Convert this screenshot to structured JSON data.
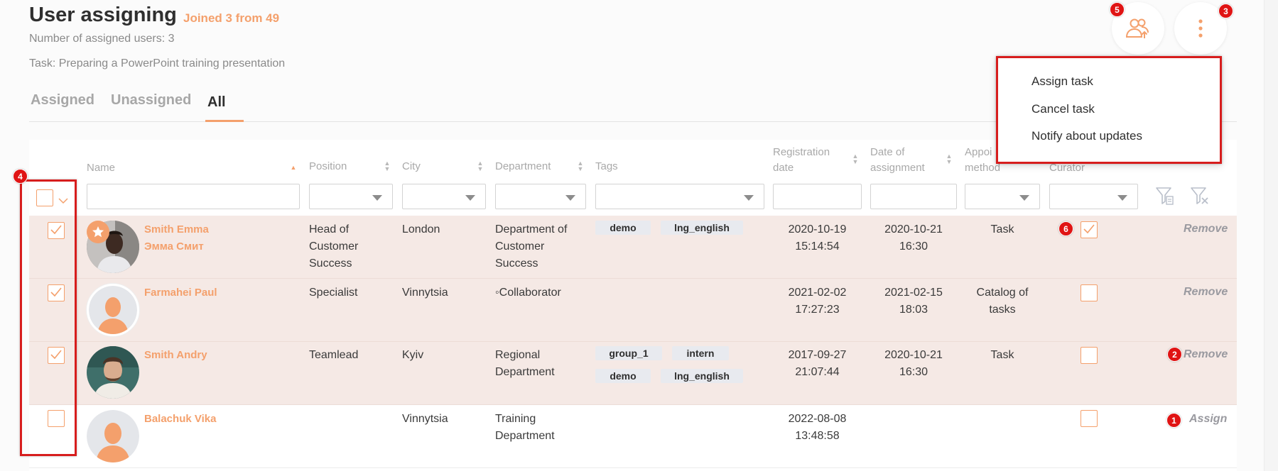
{
  "header": {
    "title": "User assigning",
    "joined": "Joined 3 from 49",
    "assigned_count": "Number of assigned users: 3",
    "task": "Task: Preparing a PowerPoint training presentation"
  },
  "tabs": [
    {
      "label": "Assigned"
    },
    {
      "label": "Unassigned"
    },
    {
      "label": "All"
    }
  ],
  "columns": {
    "name": "Name",
    "position": "Position",
    "city": "City",
    "department": "Department",
    "tags": "Tags",
    "registration_line1": "Registration",
    "registration_line2": "date",
    "assignment_line1": "Date of",
    "assignment_line2": "assignment",
    "appoint_line1": "Appoi",
    "appoint_line2": "method",
    "curator": "Curator"
  },
  "menu": {
    "items": [
      "Assign task",
      "Cancel task",
      "Notify about updates"
    ]
  },
  "badges": {
    "b1": "1",
    "b2": "2",
    "b3": "3",
    "b4": "4",
    "b5": "5",
    "b6": "6"
  },
  "rows": [
    {
      "name_line1": "Smith Emma",
      "name_line2": "Эмма Смит",
      "position": [
        "Head of",
        "Customer",
        "Success"
      ],
      "city": "London",
      "department": [
        "Department of",
        "Customer",
        "Success"
      ],
      "tags": [
        "demo",
        "lng_english"
      ],
      "reg_date": "2020-10-19",
      "reg_time": "15:14:54",
      "assign_date": "2020-10-21",
      "assign_time": "16:30",
      "method": [
        "Task"
      ],
      "action": "Remove"
    },
    {
      "name_line1": "Farmahei Paul",
      "position": [
        "Specialist"
      ],
      "city": "Vinnytsia",
      "department": [
        "◦Collaborator"
      ],
      "tags": [],
      "reg_date": "2021-02-02",
      "reg_time": "17:27:23",
      "assign_date": "2021-02-15",
      "assign_time": "18:03",
      "method": [
        "Catalog of",
        "tasks"
      ],
      "action": "Remove"
    },
    {
      "name_line1": "Smith Andry",
      "position": [
        "Teamlead"
      ],
      "city": "Kyiv",
      "department": [
        "Regional",
        "Department"
      ],
      "tags": [
        "group_1",
        "intern",
        "demo",
        "lng_english"
      ],
      "reg_date": "2017-09-27",
      "reg_time": "21:07:44",
      "assign_date": "2020-10-21",
      "assign_time": "16:30",
      "method": [
        "Task"
      ],
      "action": "Remove"
    },
    {
      "name_line1": "Balachuk Vika",
      "position": [],
      "city": "Vinnytsia",
      "department": [
        "Training",
        "Department"
      ],
      "tags": [],
      "reg_date": "2022-08-08",
      "reg_time": "13:48:58",
      "assign_date": "",
      "assign_time": "",
      "method": [],
      "action": "Assign"
    }
  ],
  "colors": {
    "accent": "#f4a06c",
    "highlight_row": "#f5e9e5",
    "annotation_red": "#d71d1d",
    "tag_bg": "#e8eaef"
  }
}
